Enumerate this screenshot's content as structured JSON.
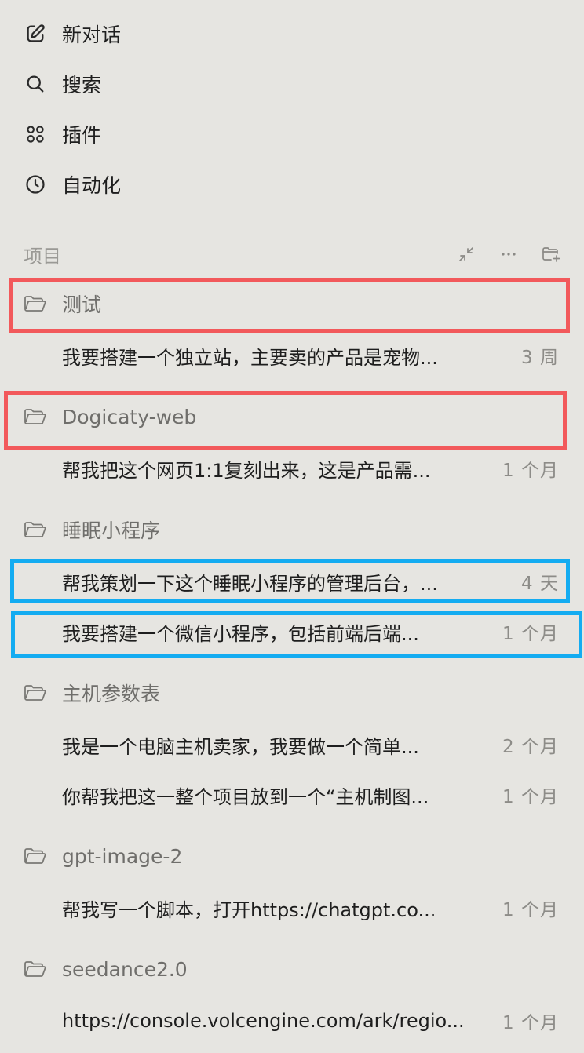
{
  "nav": {
    "items": [
      {
        "label": "新对话",
        "icon": "edit-icon"
      },
      {
        "label": "搜索",
        "icon": "search-icon"
      },
      {
        "label": "插件",
        "icon": "plugins-grid-icon"
      },
      {
        "label": "自动化",
        "icon": "clock-icon"
      }
    ]
  },
  "projects": {
    "header": "项目",
    "actions": [
      "collapse-icon",
      "more-icon",
      "new-folder-icon"
    ],
    "folders": [
      {
        "name": "测试",
        "chats": [
          {
            "title": "我要搭建一个独立站，主要卖的产品是宠物...",
            "time": "3 周"
          }
        ]
      },
      {
        "name": "Dogicaty-web",
        "chats": [
          {
            "title": "帮我把这个网页1:1复刻出来，这是产品需...",
            "time": "1 个月"
          }
        ]
      },
      {
        "name": "睡眠小程序",
        "chats": [
          {
            "title": "帮我策划一下这个睡眠小程序的管理后台，...",
            "time": "4 天"
          },
          {
            "title": "我要搭建一个微信小程序，包括前端后端...",
            "time": "1 个月"
          }
        ]
      },
      {
        "name": "主机参数表",
        "chats": [
          {
            "title": "我是一个电脑主机卖家，我要做一个简单...",
            "time": "2 个月"
          },
          {
            "title": "你帮我把这一整个项目放到一个“主机制图...",
            "time": "1 个月"
          }
        ]
      },
      {
        "name": "gpt-image-2",
        "chats": [
          {
            "title": "帮我写一个脚本，打开https://chatgpt.co...",
            "time": "1 个月"
          }
        ]
      },
      {
        "name": "seedance2.0",
        "chats": [
          {
            "title": "https://console.volcengine.com/ark/regio...",
            "time": "1 个月"
          }
        ]
      }
    ]
  },
  "colors": {
    "background": "#e6e5e1",
    "highlight_red": "#f2595b",
    "highlight_blue": "#14acf1"
  }
}
